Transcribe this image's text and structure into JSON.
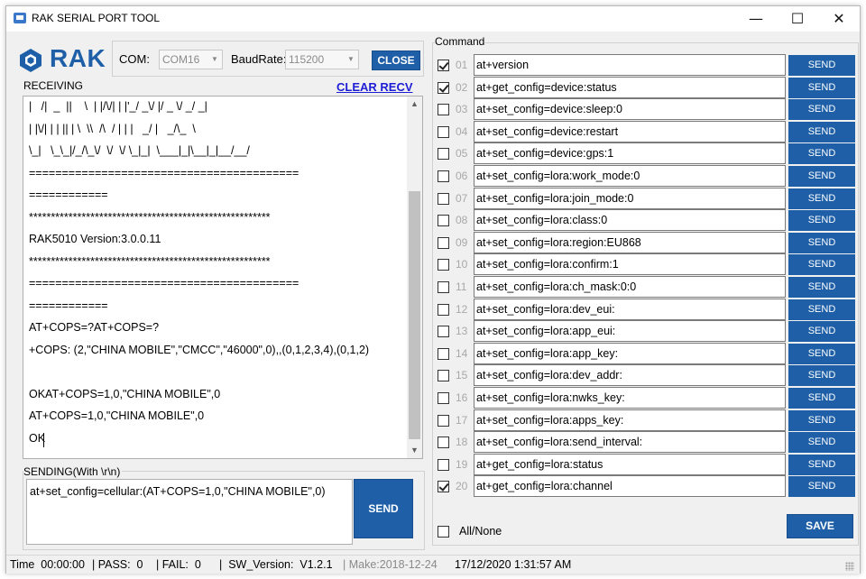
{
  "window": {
    "title": "RAK SERIAL PORT TOOL",
    "minimize": "—",
    "maximize": "☐",
    "close": "✕"
  },
  "logo": {
    "text": "RAK",
    "brand_color": "#1e5fa8"
  },
  "connection": {
    "com_label": "COM:",
    "com_value": "COM16",
    "baud_label": "BaudRate:",
    "baud_value": "115200",
    "close_button": "CLOSE"
  },
  "receiving": {
    "label": "RECEIVING",
    "clear_button": "CLEAR RECV",
    "lines": [
      "|   /|  _  ||    \\  | |/\\/| | |'_/ _\\/ |/ _ \\/ _/ _|",
      "| |\\/| | | || | \\  \\\\  /\\  / | | |   _/ |   _/\\_  \\",
      "\\_|   \\_\\_|/_/\\_\\/  \\/  \\/ \\_|_|  \\___|_|\\__|_|__/__/",
      "=========================================",
      "============",
      "*******************************************************",
      "RAK5010 Version:3.0.0.11",
      "*******************************************************",
      "=========================================",
      "============",
      "AT+COPS=?AT+COPS=?",
      "+COPS: (2,\"CHINA MOBILE\",\"CMCC\",\"46000\",0),,(0,1,2,3,4),(0,1,2)",
      "",
      "OKAT+COPS=1,0,\"CHINA MOBILE\",0",
      "AT+COPS=1,0,\"CHINA MOBILE\",0",
      "OK"
    ]
  },
  "sending": {
    "label": "SENDING(With \\r\\n)",
    "value": "at+set_config=cellular:(AT+COPS=1,0,\"CHINA MOBILE\",0)",
    "send_button": "SEND"
  },
  "command": {
    "label": "Command",
    "rows": [
      {
        "num": "01",
        "cmd": "at+version",
        "checked": true,
        "send": "SEND"
      },
      {
        "num": "02",
        "cmd": "at+get_config=device:status",
        "checked": true,
        "send": "SEND"
      },
      {
        "num": "03",
        "cmd": "at+set_config=device:sleep:0",
        "checked": false,
        "send": "SEND"
      },
      {
        "num": "04",
        "cmd": "at+set_config=device:restart",
        "checked": false,
        "send": "SEND"
      },
      {
        "num": "05",
        "cmd": "at+set_config=device:gps:1",
        "checked": false,
        "send": "SEND"
      },
      {
        "num": "06",
        "cmd": "at+set_config=lora:work_mode:0",
        "checked": false,
        "send": "SEND"
      },
      {
        "num": "07",
        "cmd": "at+set_config=lora:join_mode:0",
        "checked": false,
        "send": "SEND"
      },
      {
        "num": "08",
        "cmd": "at+set_config=lora:class:0",
        "checked": false,
        "send": "SEND"
      },
      {
        "num": "09",
        "cmd": "at+set_config=lora:region:EU868",
        "checked": false,
        "send": "SEND"
      },
      {
        "num": "10",
        "cmd": "at+set_config=lora:confirm:1",
        "checked": false,
        "send": "SEND"
      },
      {
        "num": "11",
        "cmd": "at+set_config=lora:ch_mask:0:0",
        "checked": false,
        "send": "SEND"
      },
      {
        "num": "12",
        "cmd": "at+set_config=lora:dev_eui:",
        "checked": false,
        "send": "SEND"
      },
      {
        "num": "13",
        "cmd": "at+set_config=lora:app_eui:",
        "checked": false,
        "send": "SEND"
      },
      {
        "num": "14",
        "cmd": "at+set_config=lora:app_key:",
        "checked": false,
        "send": "SEND"
      },
      {
        "num": "15",
        "cmd": "at+set_config=lora:dev_addr:",
        "checked": false,
        "send": "SEND"
      },
      {
        "num": "16",
        "cmd": "at+set_config=lora:nwks_key:",
        "checked": false,
        "send": "SEND"
      },
      {
        "num": "17",
        "cmd": "at+set_config=lora:apps_key:",
        "checked": false,
        "send": "SEND"
      },
      {
        "num": "18",
        "cmd": "at+set_config=lora:send_interval:",
        "checked": false,
        "send": "SEND"
      },
      {
        "num": "19",
        "cmd": "at+get_config=lora:status",
        "checked": false,
        "send": "SEND"
      },
      {
        "num": "20",
        "cmd": "at+get_config=lora:channel",
        "checked": true,
        "send": "SEND"
      }
    ],
    "all_none_label": "All/None",
    "save_button": "SAVE"
  },
  "status": {
    "time": "Time  00:00:00",
    "pass": "| PASS:  0",
    "fail": "| FAIL:  0",
    "sw_version": "|  SW_Version:  V1.2.1",
    "make": "| Make:2018-12-24",
    "datetime": "17/12/2020 1:31:57 AM"
  }
}
